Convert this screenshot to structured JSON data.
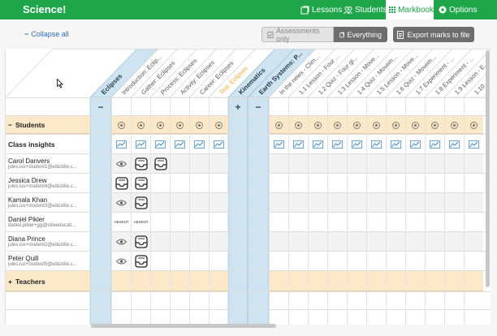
{
  "app": {
    "brand": "Science!"
  },
  "nav": {
    "lessons": "Lessons",
    "students": "Students",
    "markbook": "Markbook",
    "options": "Options"
  },
  "toolbar": {
    "collapse_all": "Collapse all",
    "assessments_only": "Assessments only",
    "everything": "Everything",
    "export": "Export marks to file"
  },
  "columns": {
    "group1": "Eclipses",
    "group1_items": [
      "Introduction: Eclip...",
      "Gather: Eclipses",
      "Process: Eclipses",
      "Activity: Eclipses",
      "Career: Eclipses",
      "Test: Eclipses"
    ],
    "group2": "Kinematics",
    "group3": "Earth Systems: P...",
    "group3_items": [
      "In the news - Clim...",
      "1.1 Lesson - Four ...",
      "1.2 Quiz - Four gl...",
      "1.3 Lesson - Move...",
      "1.4 Quiz - Movem...",
      "1.5 Lesson - Move...",
      "1.6 Quiz - Movem...",
      "1.7 Experiment - ...",
      "1.8 Experiment - ...",
      "1.9 Lesson - E...",
      "1.10 ..."
    ]
  },
  "sections": {
    "students": "Students",
    "class_insights": "Class insights",
    "teachers": "Teachers"
  },
  "students": [
    {
      "name": "Carol Danvers",
      "email": "jules.ius+student1@edustile.c..."
    },
    {
      "name": "Jessica Drew",
      "email": "jules.ius+student4@edustile.c..."
    },
    {
      "name": "Kamala Khan",
      "email": "jules.ius+student3@edustile.c..."
    },
    {
      "name": "Daniel Pikler",
      "email": "daniel.pikler+gg@stileeducati..."
    },
    {
      "name": "Diana Prince",
      "email": "jules.ius+student2@edustile.c..."
    },
    {
      "name": "Peter Quill",
      "email": "jules.ius+student5@edustile.c..."
    }
  ],
  "marks": [
    [
      "view",
      "inbox",
      "inbox"
    ],
    [
      "inbox",
      "inbox",
      ""
    ],
    [
      "view",
      "inbox",
      ""
    ],
    [
      "ABSENT",
      "ABSENT",
      ""
    ],
    [
      "view",
      "inbox",
      ""
    ],
    [
      "view",
      "inbox",
      ""
    ]
  ],
  "colors": {
    "brand": "#1fa64a",
    "group_col": "#cfe4f0",
    "band": "#fbe8c8",
    "test": "#f0a830"
  }
}
